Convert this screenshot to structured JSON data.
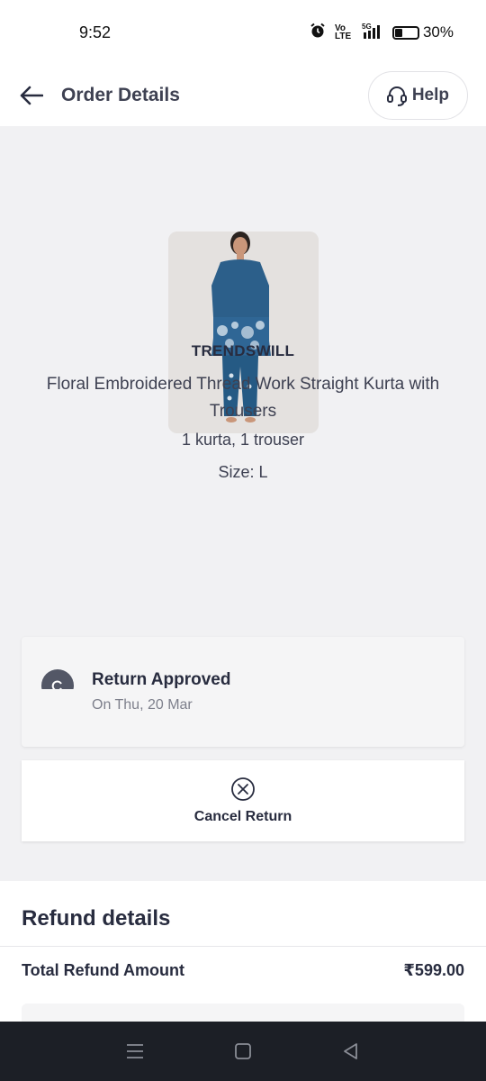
{
  "status_bar": {
    "time": "9:52",
    "network_volte": "Vo LTE",
    "network_5g": "5G",
    "battery_percent": "30%",
    "battery_level": 0.3
  },
  "header": {
    "title": "Order Details",
    "help_label": "Help"
  },
  "product": {
    "brand": "TRENDSWILL",
    "name": "Floral Embroidered Thread Work Straight Kurta with Trousers",
    "quantity": "1 kurta, 1 trouser",
    "size": "Size: L"
  },
  "return_status": {
    "title": "Return Approved",
    "date": "On Thu, 20 Mar"
  },
  "cancel": {
    "label": "Cancel Return"
  },
  "refund": {
    "title": "Refund details",
    "total_label": "Total Refund Amount",
    "total_amount": "₹599.00"
  },
  "colors": {
    "primary_text": "#282c3f",
    "secondary_text": "#7e808c",
    "background": "#f1f1f3",
    "nav_bar": "#1c1f26",
    "kurta_blue": "#2c5f8a"
  }
}
